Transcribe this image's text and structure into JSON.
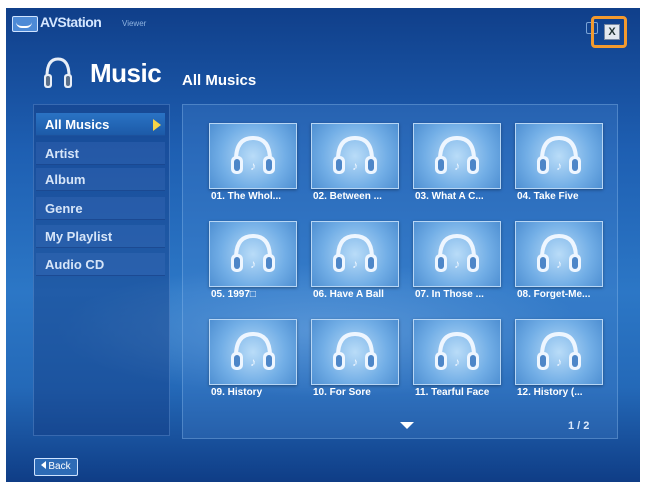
{
  "app": {
    "name": "AVStation",
    "subtitle": "Viewer"
  },
  "window": {
    "close_label": "X"
  },
  "header": {
    "title": "Music",
    "icon": "headphone-icon"
  },
  "section_title": "All Musics",
  "sidebar": {
    "items": [
      {
        "label": "All Musics",
        "active": true
      },
      {
        "label": "Artist",
        "active": false
      },
      {
        "label": "Album",
        "active": false
      },
      {
        "label": "Genre",
        "active": false
      },
      {
        "label": "My Playlist",
        "active": false
      },
      {
        "label": "Audio CD",
        "active": false
      }
    ]
  },
  "tracks": [
    {
      "label": "01. The Whol..."
    },
    {
      "label": "02. Between ..."
    },
    {
      "label": "03. What A C..."
    },
    {
      "label": "04. Take Five"
    },
    {
      "label": "05. 1997□"
    },
    {
      "label": "06. Have A Ball"
    },
    {
      "label": "07. In Those ..."
    },
    {
      "label": "08. Forget-Me..."
    },
    {
      "label": "09. History"
    },
    {
      "label": "10. For Sore"
    },
    {
      "label": "11. Tearful Face"
    },
    {
      "label": "12. History (..."
    }
  ],
  "pagination": {
    "current": 1,
    "total": 2,
    "text": "1 / 2"
  },
  "back_label": "Back",
  "colors": {
    "accent": "#f39a2e",
    "background": "#1e5fb2",
    "arrow": "#f5d447"
  }
}
